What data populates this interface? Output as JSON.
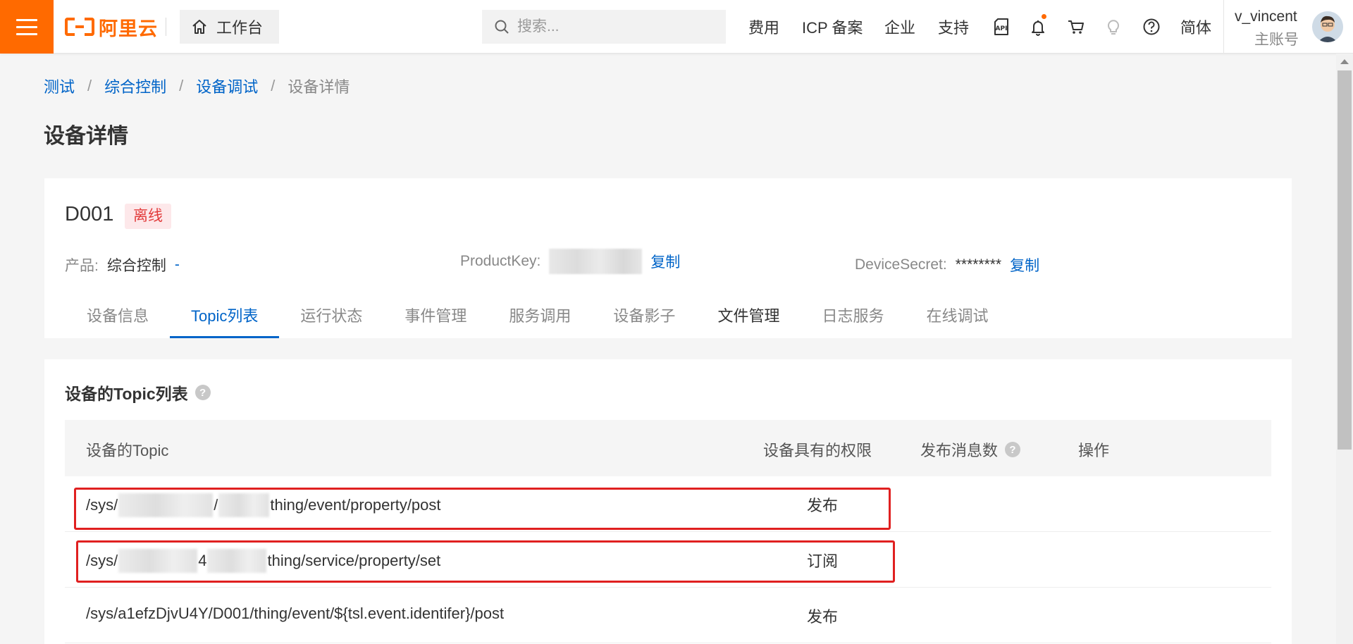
{
  "topbar": {
    "logo_text": "阿里云",
    "workbench_label": "工作台",
    "search_placeholder": "搜索...",
    "nav": {
      "cost": "费用",
      "icp": "ICP 备案",
      "enterprise": "企业",
      "support": "支持",
      "language": "简体"
    },
    "user": {
      "name": "v_vincent",
      "role": "主账号"
    },
    "icons": [
      "menu-icon",
      "home-icon",
      "search-icon",
      "api-icon",
      "bell-icon",
      "cart-icon",
      "lightbulb-icon",
      "help-icon"
    ],
    "accent_color": "#ff6a00"
  },
  "breadcrumb": {
    "items": [
      "测试",
      "综合控制",
      "设备调试",
      "设备详情"
    ],
    "separator": "/"
  },
  "page_title": "设备详情",
  "device": {
    "name": "D001",
    "status": "离线",
    "product_label": "产品:",
    "product_value": "综合控制",
    "product_link": "-",
    "productkey_label": "ProductKey:",
    "productkey_copy": "复制",
    "secret_label": "DeviceSecret:",
    "secret_value": "********",
    "secret_copy": "复制"
  },
  "tabs": [
    "设备信息",
    "Topic列表",
    "运行状态",
    "事件管理",
    "服务调用",
    "设备影子",
    "文件管理",
    "日志服务",
    "在线调试"
  ],
  "active_tab": "Topic列表",
  "topic_section": {
    "title": "设备的Topic列表",
    "help_symbol": "?",
    "columns": {
      "topic": "设备的Topic",
      "permission": "设备具有的权限",
      "msg_count": "发布消息数",
      "action": "操作"
    },
    "rows": [
      {
        "topic_prefix": "/sys/",
        "topic_mid": "/",
        "topic_suffix": "thing/event/property/post",
        "permission": "发布"
      },
      {
        "topic_prefix": "/sys/",
        "topic_mid": "4",
        "topic_suffix": "thing/service/property/set",
        "permission": "订阅"
      },
      {
        "topic": "/sys/a1efzDjvU4Y/D001/thing/event/${tsl.event.identifer}/post",
        "permission": "发布"
      }
    ]
  },
  "link_color": "#0064c8",
  "highlight_color": "#e02020"
}
